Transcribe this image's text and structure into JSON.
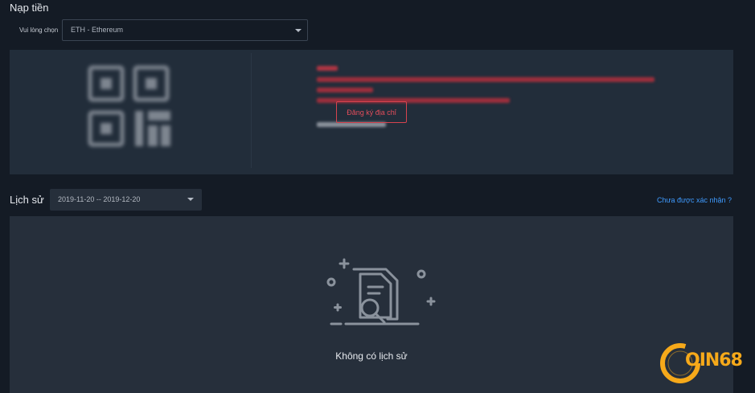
{
  "deposit": {
    "title": "Nạp tiền",
    "select_label": "Vui lòng chọn",
    "selected_coin": "ETH - Ethereum",
    "register_button": "Đăng ký địa chỉ",
    "accent_color": "#e24d5b"
  },
  "history": {
    "title": "Lịch sử",
    "date_range": "2019-11-20 -- 2019-12-20",
    "unconfirmed_link": "Chưa được xác nhận ?",
    "empty_text": "Không có lịch sử",
    "link_color": "#3f9bff"
  },
  "watermark": {
    "brand": "OIN68",
    "color": "#f6a91a"
  },
  "icons": {
    "qr": "qr-code-icon",
    "empty": "document-search-icon",
    "select_caret": "chevron-down-icon"
  }
}
